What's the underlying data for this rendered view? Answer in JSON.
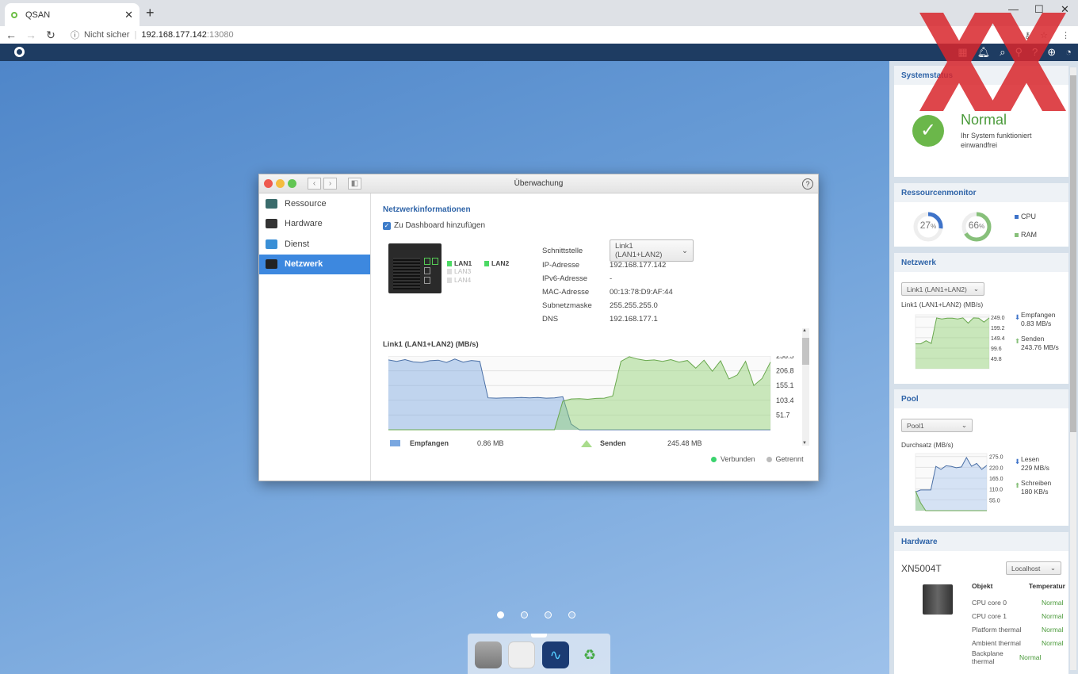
{
  "browser": {
    "tab_title": "QSAN",
    "security": "Nicht sicher",
    "host": "192.168.177.142",
    "port": ":13080"
  },
  "window": {
    "title": "Überwachung",
    "help": "?"
  },
  "sidebar": {
    "items": [
      {
        "label": "Ressource",
        "color": "#3a6b6b"
      },
      {
        "label": "Hardware",
        "color": "#333"
      },
      {
        "label": "Dienst",
        "color": "#3a8fd6"
      },
      {
        "label": "Netzwerk",
        "color": "#222"
      }
    ],
    "active": 3
  },
  "network": {
    "heading": "Netzwerkinformationen",
    "dashboard_checkbox": "Zu Dashboard hinzufügen",
    "dashboard_checked": true,
    "lans": [
      {
        "label": "LAN1",
        "connected": true
      },
      {
        "label": "LAN2",
        "connected": true
      },
      {
        "label": "LAN3",
        "connected": false
      },
      {
        "label": "LAN4",
        "connected": false
      }
    ],
    "fields": [
      {
        "k": "Schnittstelle",
        "v": "Link1 (LAN1+LAN2)"
      },
      {
        "k": "IP-Adresse",
        "v": "192.168.177.142"
      },
      {
        "k": "IPv6-Adresse",
        "v": "-"
      },
      {
        "k": "MAC-Adresse",
        "v": "00:13:78:D9:AF:44"
      },
      {
        "k": "Subnetzmaske",
        "v": "255.255.255.0"
      },
      {
        "k": "DNS",
        "v": "192.168.177.1"
      }
    ],
    "legend": {
      "receive": "Empfangen",
      "receive_total": "0.86 MB",
      "send": "Senden",
      "send_total": "245.48 MB",
      "connected": "Verbunden",
      "disconnected": "Getrennt"
    }
  },
  "chart_data": [
    {
      "type": "area",
      "title": "Link1 (LAN1+LAN2) (MB/s)",
      "ylim": [
        0,
        258.5
      ],
      "yticks": [
        "258.5",
        "206.8",
        "155.1",
        "103.4",
        "51.7"
      ],
      "series": [
        {
          "name": "Empfangen",
          "color": "#7aa7e0",
          "values": [
            245,
            240,
            246,
            238,
            236,
            242,
            244,
            236,
            248,
            237,
            243,
            240,
            112,
            111,
            112,
            112,
            113,
            112,
            113,
            111,
            112,
            116,
            20,
            0,
            0,
            0,
            0,
            0,
            0,
            0,
            0,
            0,
            0,
            0,
            0,
            0,
            0,
            0,
            0,
            0,
            0,
            0,
            0,
            0,
            0,
            0,
            0
          ]
        },
        {
          "name": "Senden",
          "color": "#8ed06f",
          "values": [
            0,
            0,
            0,
            0,
            0,
            0,
            0,
            0,
            0,
            0,
            0,
            0,
            0,
            0,
            0,
            0,
            0,
            0,
            0,
            0,
            0,
            100,
            108,
            109,
            107,
            110,
            111,
            118,
            240,
            256,
            248,
            243,
            245,
            240,
            246,
            237,
            243,
            216,
            244,
            205,
            242,
            178,
            192,
            240,
            155,
            180,
            237
          ]
        }
      ]
    },
    {
      "type": "area",
      "title": "Link1 (LAN1+LAN2) (MB/s)",
      "ylim": [
        0,
        260
      ],
      "yticks": [
        "249.0",
        "199.2",
        "149.4",
        "99.6",
        "49.8"
      ],
      "series": [
        {
          "name": "Senden",
          "color": "#8ed06f",
          "values": [
            120,
            120,
            135,
            122,
            245,
            240,
            244,
            244,
            240,
            245,
            220,
            245,
            244,
            225,
            245
          ]
        }
      ]
    },
    {
      "type": "area",
      "title": "Durchsatz (MB/s)",
      "ylim": [
        0,
        290
      ],
      "yticks": [
        "275.0",
        "220.0",
        "165.0",
        "110.0",
        "55.0"
      ],
      "series": [
        {
          "name": "Lesen",
          "color": "#a9c6ee",
          "values": [
            95,
            105,
            105,
            105,
            225,
            210,
            228,
            225,
            218,
            222,
            270,
            225,
            240,
            210,
            230
          ]
        },
        {
          "name": "Schreiben",
          "color": "#8ed06f",
          "values": [
            100,
            40,
            0,
            0,
            0,
            0,
            0,
            0,
            0,
            0,
            0,
            0,
            0,
            0,
            0
          ]
        }
      ]
    }
  ],
  "panel": {
    "systemstatus": {
      "title": "Systemstatus",
      "status": "Normal",
      "desc": "Ihr System funktioniert einwandfrei"
    },
    "resources": {
      "title": "Ressourcenmonitor",
      "cpu": 27,
      "ram": 66,
      "cpu_text": "27",
      "ram_text": "66",
      "pct": "%",
      "cpu_label": "CPU",
      "ram_label": "RAM"
    },
    "network": {
      "title": "Netzwerk",
      "select": "Link1 (LAN1+LAN2)",
      "caption": "Link1 (LAN1+LAN2) (MB/s)",
      "recv_label": "Empfangen",
      "recv": "0.83 MB/s",
      "send_label": "Senden",
      "send": "243.76 MB/s"
    },
    "pool": {
      "title": "Pool",
      "select": "Pool1",
      "caption": "Durchsatz (MB/s)",
      "read_label": "Lesen",
      "read": "229 MB/s",
      "write_label": "Schreiben",
      "write": "180 KB/s"
    },
    "hardware": {
      "title": "Hardware",
      "model": "XN5004T",
      "select": "Localhost",
      "col1": "Objekt",
      "col2": "Temperatur",
      "rows": [
        {
          "o": "CPU core 0",
          "t": "Normal"
        },
        {
          "o": "CPU core 1",
          "t": "Normal"
        },
        {
          "o": "Platform thermal",
          "t": "Normal"
        },
        {
          "o": "Ambient thermal",
          "t": "Normal"
        },
        {
          "o": "Backplane thermal",
          "t": "Normal"
        }
      ]
    }
  },
  "desktop": {
    "pages": 4,
    "active_page": 0
  }
}
